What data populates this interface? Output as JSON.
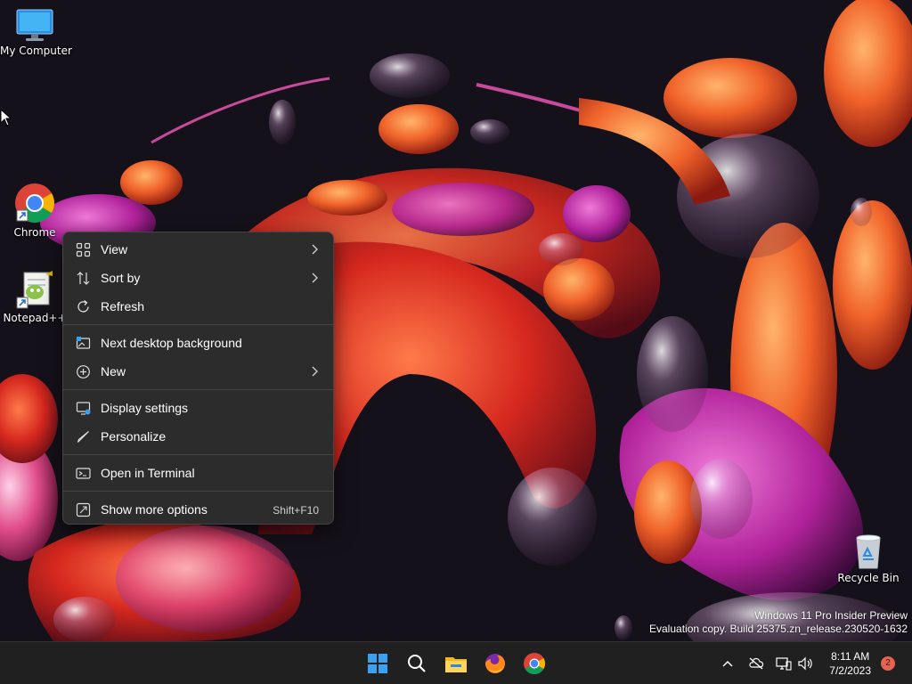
{
  "desktop_icons": {
    "my_computer": "My Computer",
    "chrome": "Chrome",
    "notepadpp": "Notepad++",
    "recycle_bin": "Recycle Bin"
  },
  "context_menu": {
    "view": "View",
    "sort_by": "Sort by",
    "refresh": "Refresh",
    "next_background": "Next desktop background",
    "new": "New",
    "display_settings": "Display settings",
    "personalize": "Personalize",
    "open_terminal": "Open in Terminal",
    "show_more": "Show more options",
    "show_more_shortcut": "Shift+F10"
  },
  "watermark": {
    "line1": "Windows 11 Pro Insider Preview",
    "line2": "Evaluation copy. Build 25375.zn_release.230520-1632"
  },
  "taskbar": {
    "apps": [
      "start-icon",
      "search-icon",
      "file-explorer-icon",
      "firefox-icon",
      "chrome-icon"
    ],
    "time": "8:11 AM",
    "date": "7/2/2023",
    "notification_count": "2"
  },
  "colors": {
    "menu_bg": "#2c2c2c",
    "taskbar_bg": "#202020",
    "accent_blue": "#3aa0f0"
  }
}
